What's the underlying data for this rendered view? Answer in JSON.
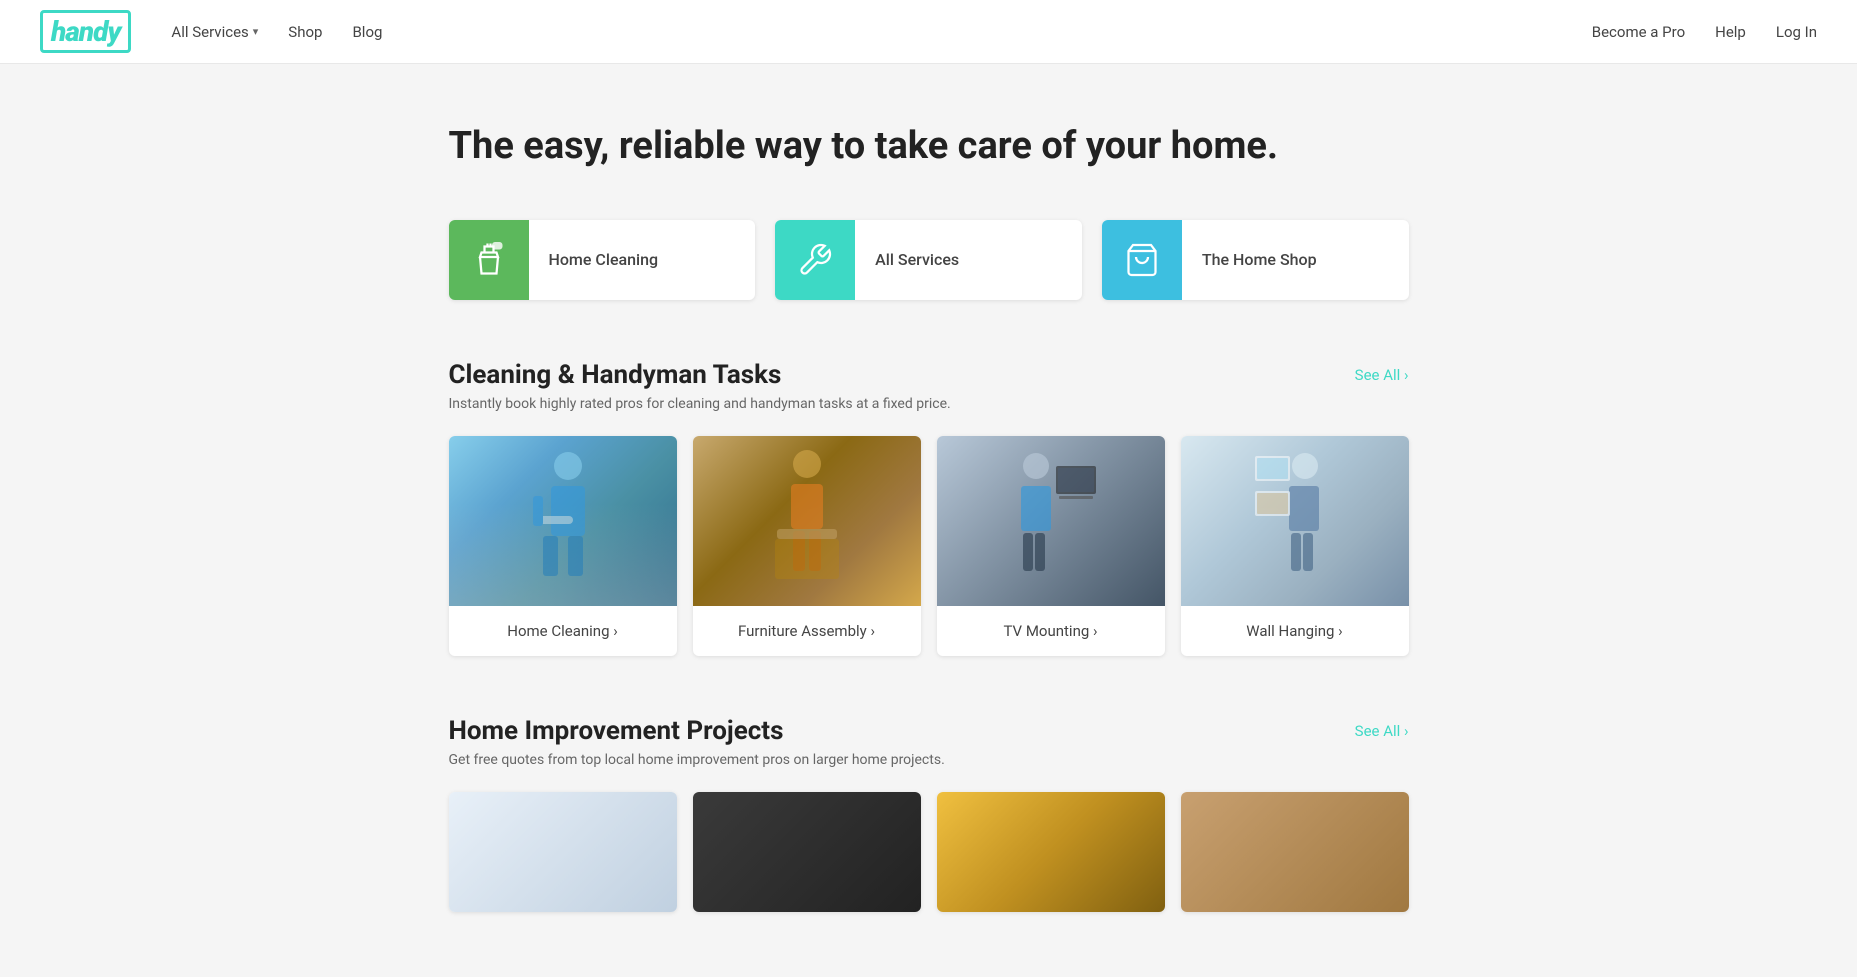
{
  "brand": {
    "logo": "handy"
  },
  "nav": {
    "left": [
      {
        "label": "All Services",
        "hasDropdown": true
      },
      {
        "label": "Shop",
        "hasDropdown": false
      },
      {
        "label": "Blog",
        "hasDropdown": false
      }
    ],
    "right": [
      {
        "label": "Become a Pro"
      },
      {
        "label": "Help"
      },
      {
        "label": "Log In"
      }
    ]
  },
  "hero": {
    "title": "The easy, reliable way to take care of your home."
  },
  "featureCards": [
    {
      "id": "home-cleaning",
      "label": "Home Cleaning",
      "colorClass": "green",
      "icon": "spray"
    },
    {
      "id": "all-services",
      "label": "All Services",
      "colorClass": "teal",
      "icon": "wrench"
    },
    {
      "id": "the-home-shop",
      "label": "The Home Shop",
      "colorClass": "blue",
      "icon": "cart"
    }
  ],
  "cleaningSection": {
    "title": "Cleaning & Handyman Tasks",
    "subtitle": "Instantly book highly rated pros for cleaning and handyman tasks at a fixed price.",
    "seeAllLabel": "See All ›",
    "cards": [
      {
        "id": "home-cleaning",
        "label": "Home Cleaning ›",
        "imgClass": "img-home-cleaning"
      },
      {
        "id": "furniture-assembly",
        "label": "Furniture Assembly ›",
        "imgClass": "img-furniture"
      },
      {
        "id": "tv-mounting",
        "label": "TV Mounting ›",
        "imgClass": "img-tv-mounting"
      },
      {
        "id": "wall-hanging",
        "label": "Wall Hanging ›",
        "imgClass": "img-wall-hanging"
      }
    ]
  },
  "improvementSection": {
    "title": "Home Improvement Projects",
    "subtitle": "Get free quotes from top local home improvement pros on larger home projects.",
    "seeAllLabel": "See All ›",
    "cards": [
      {
        "id": "imp-1",
        "imgClass": "img-imp-1"
      },
      {
        "id": "imp-2",
        "imgClass": "img-imp-2"
      },
      {
        "id": "imp-3",
        "imgClass": "img-imp-3"
      },
      {
        "id": "imp-4",
        "imgClass": "img-imp-4"
      }
    ]
  }
}
